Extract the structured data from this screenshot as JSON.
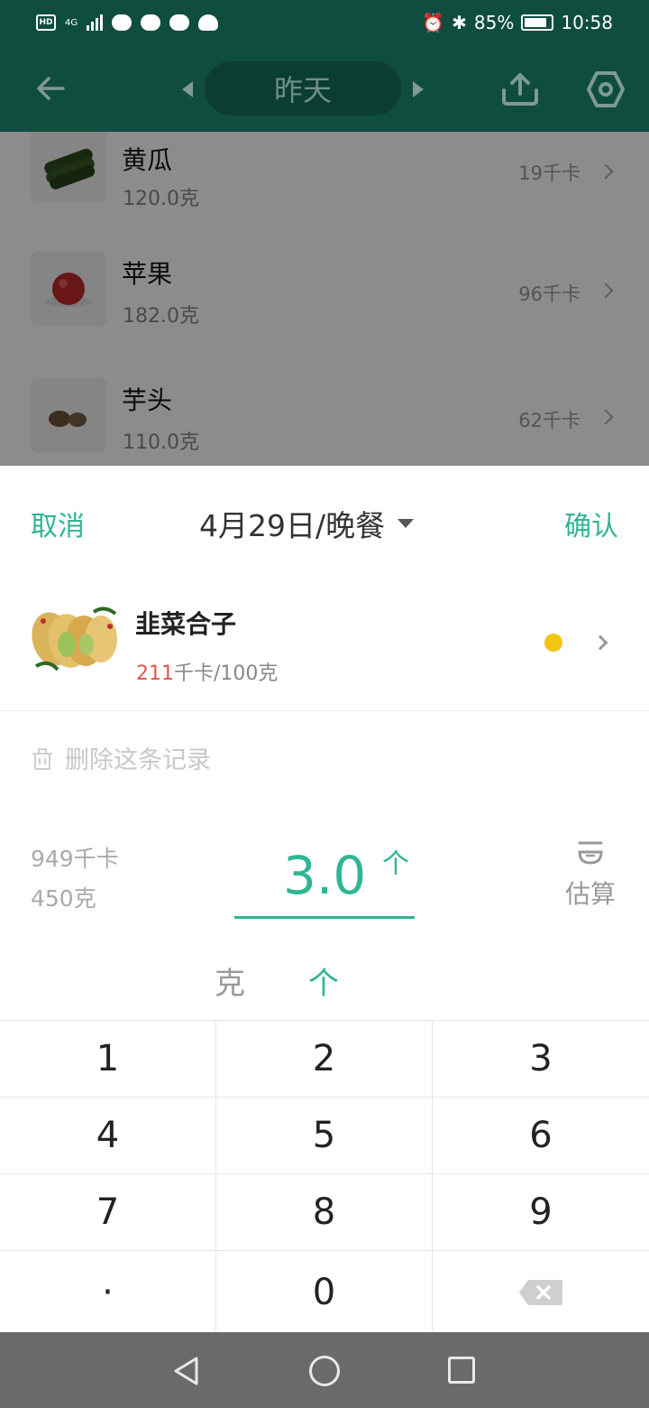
{
  "status_bar": {
    "hd": "HD",
    "network": "4G",
    "battery": "85%",
    "time": "10:58",
    "battery_level": 0.85
  },
  "header": {
    "date_label": "昨天"
  },
  "food_list": [
    {
      "name": "黄瓜",
      "weight": "120.0克",
      "kcal": "19千卡"
    },
    {
      "name": "苹果",
      "weight": "182.0克",
      "kcal": "96千卡"
    },
    {
      "name": "芋头",
      "weight": "110.0克",
      "kcal": "62千卡"
    }
  ],
  "sheet": {
    "cancel": "取消",
    "confirm": "确认",
    "meal": "4月29日/晚餐",
    "food": {
      "name": "韭菜合子",
      "kcal_value": "211",
      "kcal_rest": "千卡/100克",
      "dot_color": "#f4c414"
    },
    "delete": "删除这条记录",
    "totals": {
      "kcal": "949千卡",
      "weight": "450克"
    },
    "amount": {
      "value": "3.0",
      "unit": "个"
    },
    "estimate": "估算",
    "units": [
      "克",
      "个"
    ]
  },
  "keypad": {
    "keys": [
      "1",
      "2",
      "3",
      "4",
      "5",
      "6",
      "7",
      "8",
      "9",
      "·",
      "0"
    ]
  },
  "colors": {
    "accent": "#2fb693",
    "header_bg": "#0f4d3f",
    "kcal_red": "#e05454"
  }
}
